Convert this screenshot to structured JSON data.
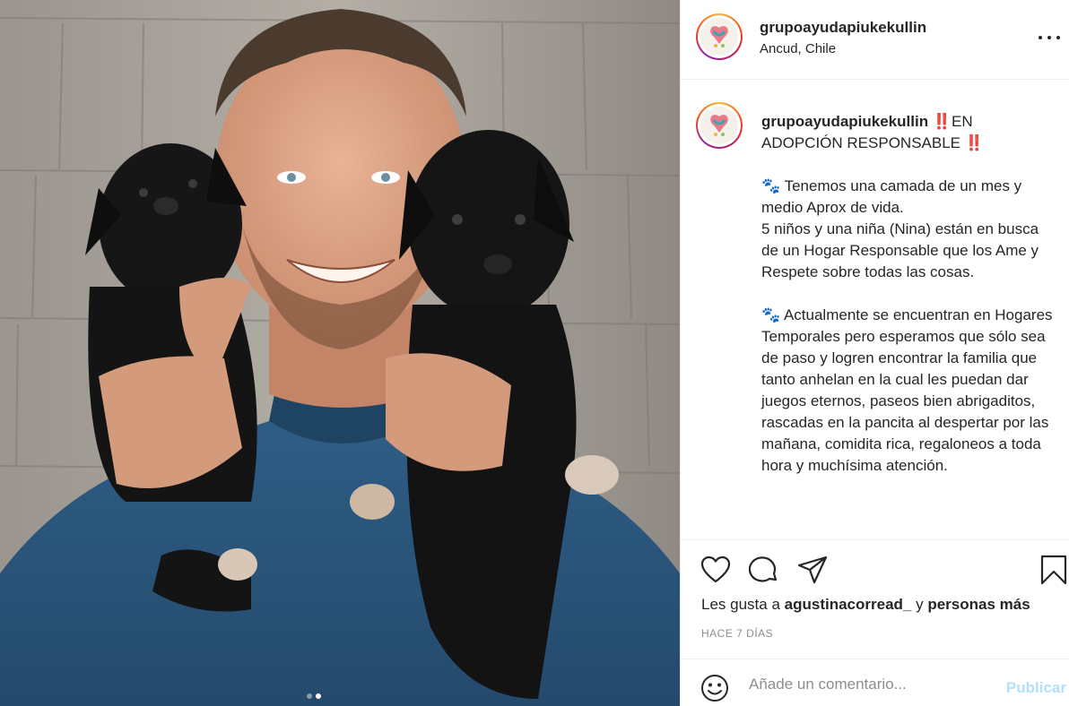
{
  "post": {
    "username": "grupoayudapiukekullin",
    "location": "Ancud, Chile",
    "carousel": {
      "count": 2,
      "active_index": 1
    }
  },
  "caption": {
    "username": "grupoayudapiukekullin",
    "lines": [
      "‼️EN ADOPCIÓN RESPONSABLE ‼️",
      "",
      "🐾 Tenemos una camada de un mes y medio Aprox de vida.",
      "5 niños y una niña (Nina) están en busca de un Hogar Responsable que los Ame y Respete sobre todas las cosas.",
      "",
      "🐾 Actualmente se encuentran en Hogares Temporales pero esperamos que sólo sea de paso y logren encontrar la familia que tanto anhelan en la cual les puedan dar juegos eternos, paseos bien abrigaditos, rascadas en la pancita al despertar por las mañana, comidita rica, regaloneos a toda hora y muchísima atención."
    ]
  },
  "likes": {
    "prefix": "Les gusta a",
    "user": "agustinacorread_",
    "connector": "y",
    "others": "personas más"
  },
  "time_ago": "HACE 7 DÍAS",
  "comment": {
    "placeholder": "Añade un comentario...",
    "value": "",
    "submit_label": "Publicar"
  },
  "icons": {
    "more": "more-horizontal-icon",
    "like": "heart-icon",
    "comment": "speech-bubble-icon",
    "share": "paper-plane-icon",
    "save": "bookmark-icon",
    "emoji": "smiley-icon"
  },
  "colors": {
    "text": "#262626",
    "muted": "#8e8e8e",
    "divider": "#efefef",
    "publish_disabled": "#b2dffc"
  }
}
